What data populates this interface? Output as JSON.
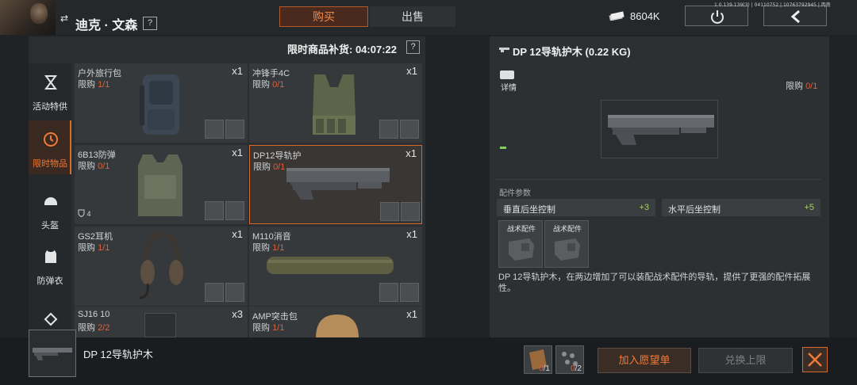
{
  "header": {
    "player_name": "迪克 · 文森",
    "help_glyph": "?",
    "tabs": {
      "buy": "购买",
      "sell": "出售"
    },
    "money": "8604K",
    "version": "1.0.139.139(3) | 04110752 | 10763792945 | 丙南"
  },
  "categories": [
    {
      "label": "活动特供",
      "icon": "hourglass-icon"
    },
    {
      "label": "限时物品",
      "icon": "clock-icon",
      "active": true
    },
    {
      "label": "头盔",
      "icon": "helmet-icon"
    },
    {
      "label": "防弹衣",
      "icon": "vest-icon"
    },
    {
      "label": "",
      "icon": "backpack-icon"
    }
  ],
  "restock": {
    "label": "限时商品补货: 04:07:22",
    "help": "?"
  },
  "limit_prefix": "限购 ",
  "items": [
    {
      "name": "户外旅行包",
      "qty": "x1",
      "limit": "1/1"
    },
    {
      "name": "冲锋手4C",
      "qty": "x1",
      "limit": "0/1"
    },
    {
      "name": "6B13防弹",
      "qty": "x1",
      "limit": "0/1",
      "armor": "4"
    },
    {
      "name": "DP12导轨护",
      "qty": "x1",
      "limit": "0/1",
      "selected": true
    },
    {
      "name": "GS2耳机",
      "qty": "x1",
      "limit": "1/1"
    },
    {
      "name": "M110消音",
      "qty": "x1",
      "limit": "1/1"
    },
    {
      "name": "SJ16 10",
      "qty": "x3",
      "limit": "2/2"
    },
    {
      "name": "AMP突击包",
      "qty": "x1",
      "limit": "1/1"
    }
  ],
  "detail": {
    "title": "DP 12导轨护木 (0.22 KG)",
    "details_label": "详情",
    "limit_label": "限购 ",
    "limit_value": "0/1",
    "params_label": "配件参数",
    "stats": [
      {
        "label": "垂直后坐控制",
        "value": "+3"
      },
      {
        "label": "水平后坐控制",
        "value": "+5"
      }
    ],
    "slots": [
      "战术配件",
      "战术配件"
    ],
    "description": "DP 12导轨护木，在两边增加了可以装配战术配件的导轨，提供了更强的配件拓展性。"
  },
  "bottom": {
    "item_name": "DP 12导轨护木",
    "costs": [
      {
        "count": "0",
        "total": "/1"
      },
      {
        "count": "0",
        "total": "/2"
      }
    ],
    "wishlist": "加入愿望单",
    "redeem": "兑换上限"
  },
  "colors": {
    "accent": "#f07a38",
    "limit_red": "#e0603a",
    "stat_green": "#a8d060"
  }
}
